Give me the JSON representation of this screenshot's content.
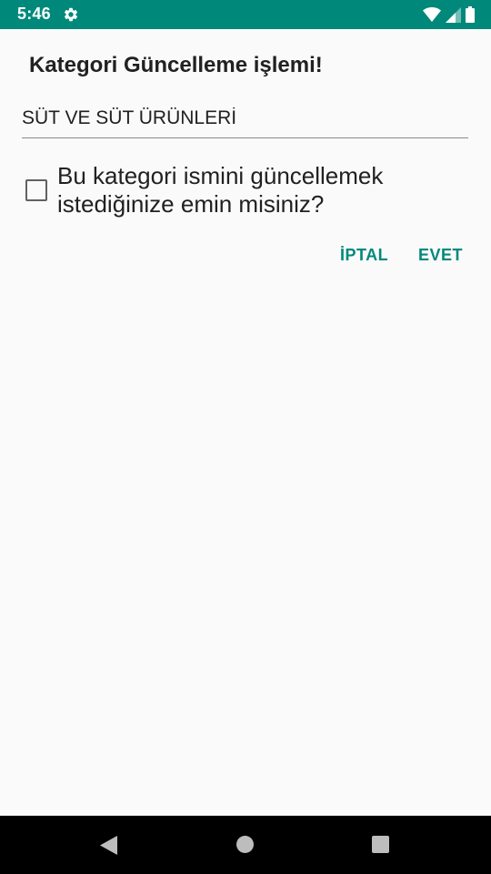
{
  "status_bar": {
    "time": "5:46",
    "background_color": "#00897b",
    "icons": [
      "settings-icon",
      "wifi-icon",
      "cellular-signal-icon",
      "battery-icon"
    ]
  },
  "dialog": {
    "title": "Kategori Güncelleme işlemi!",
    "category_field": {
      "value": "SÜT VE SÜT ÜRÜNLERİ"
    },
    "confirm_checkbox": {
      "label": "Bu kategori ismini güncellemek istediğinize emin misiniz?",
      "checked": false
    },
    "buttons": {
      "cancel_label": "İPTAL",
      "ok_label": "EVET"
    },
    "accent_color": "#00897b"
  },
  "nav_bar": {
    "icons": [
      "back-icon",
      "home-icon",
      "recents-icon"
    ]
  }
}
